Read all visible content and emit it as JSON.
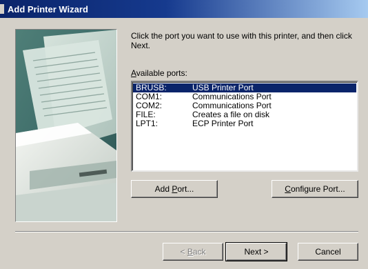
{
  "window": {
    "title": "Add Printer Wizard"
  },
  "instruction": "Click the port you want to use with this printer, and then click Next.",
  "ports_label": {
    "mnemonic": "A",
    "rest": "vailable ports:"
  },
  "ports": [
    {
      "port": "BRUSB:",
      "description": "USB Printer Port",
      "selected": true
    },
    {
      "port": "COM1:",
      "description": "Communications Port",
      "selected": false
    },
    {
      "port": "COM2:",
      "description": "Communications Port",
      "selected": false
    },
    {
      "port": "FILE:",
      "description": "Creates a file on disk",
      "selected": false
    },
    {
      "port": "LPT1:",
      "description": "ECP Printer Port",
      "selected": false
    }
  ],
  "buttons": {
    "add_port": {
      "pre": "Add ",
      "mnemonic": "P",
      "post": "ort..."
    },
    "configure_port": {
      "pre": "",
      "mnemonic": "C",
      "post": "onfigure Port..."
    },
    "back": {
      "pre": "< ",
      "mnemonic": "B",
      "post": "ack"
    },
    "next": "Next >",
    "cancel": "Cancel"
  },
  "colors": {
    "titlebar_start": "#0a246a",
    "titlebar_end": "#a6caf0",
    "selection": "#0a246a",
    "face": "#d4d0c8"
  }
}
